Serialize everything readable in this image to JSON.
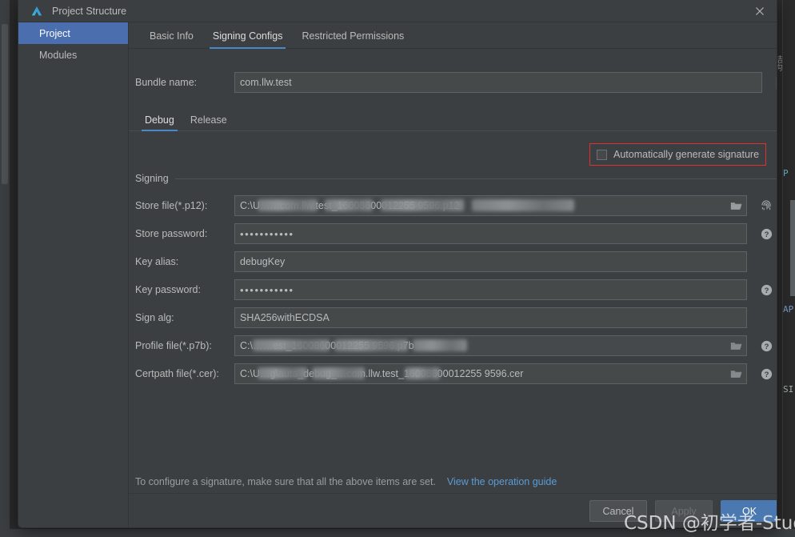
{
  "window": {
    "title": "Project Structure",
    "logo_icon": "deveco-studio-logo",
    "close_icon": "close-icon"
  },
  "sidebar": {
    "items": [
      {
        "label": "Project",
        "selected": true
      },
      {
        "label": "Modules",
        "selected": false
      }
    ]
  },
  "tabs": [
    {
      "label": "Basic Info",
      "active": false
    },
    {
      "label": "Signing Configs",
      "active": true
    },
    {
      "label": "Restricted Permissions",
      "active": false
    }
  ],
  "bundle": {
    "label": "Bundle name:",
    "value": "com.llw.test",
    "edit_icon": "edit-square-icon"
  },
  "subtabs": [
    {
      "label": "Debug",
      "active": true
    },
    {
      "label": "Release",
      "active": false
    }
  ],
  "autogen": {
    "label": "Automatically generate signature",
    "checked": false,
    "highlight_color": "#e03030",
    "checkbox_icon": "checkbox-unchecked-icon"
  },
  "signing": {
    "group_title": "Signing",
    "fields": [
      {
        "label": "Store file(*.p12):",
        "value": "C:\\U……com.llw.test_16008600012255 9596.p12",
        "display_prefix": "C:\\U",
        "display_suffix": "com.llw.test_16008600012255 9596.p12",
        "type": "file",
        "redacted": true,
        "folder_icon": "folder-open-icon",
        "trailing_icon": "fingerprint-icon"
      },
      {
        "label": "Store password:",
        "value": "•••••••••••",
        "type": "password",
        "redacted": false,
        "folder_icon": "",
        "trailing_icon": "help-icon"
      },
      {
        "label": "Key alias:",
        "value": "debugKey",
        "type": "text",
        "redacted": false,
        "folder_icon": "",
        "trailing_icon": ""
      },
      {
        "label": "Key password:",
        "value": "•••••••••••",
        "type": "password",
        "redacted": false,
        "folder_icon": "",
        "trailing_icon": "help-icon"
      },
      {
        "label": "Sign alg:",
        "value": "SHA256withECDSA",
        "type": "text",
        "redacted": false,
        "folder_icon": "",
        "trailing_icon": ""
      },
      {
        "label": "Profile file(*.p7b):",
        "value": "C:\\……est_16008600012255 9596.p7b",
        "display_prefix": "C:\\",
        "display_suffix": "est_16008600012255 9596.p7b",
        "type": "file",
        "redacted": true,
        "folder_icon": "folder-open-icon",
        "trailing_icon": "help-icon"
      },
      {
        "label": "Certpath file(*.cer):",
        "value": "C:\\U…g\\auto_debug_…com.llw.test_16008600012255 9596.cer",
        "display_prefix": "C:\\U",
        "display_suffix": "g\\auto_debug_……com.llw.test_16008600012255 9596.cer",
        "type": "file",
        "redacted": true,
        "folder_icon": "folder-open-icon",
        "trailing_icon": "help-icon"
      }
    ]
  },
  "footer": {
    "note": "To configure a signature, make sure that all the above items are set.",
    "link": "View the operation guide"
  },
  "buttons": [
    {
      "label": "Cancel",
      "style": "default",
      "enabled": true
    },
    {
      "label": "Apply",
      "style": "disabled",
      "enabled": false
    },
    {
      "label": "OK",
      "style": "primary",
      "enabled": true
    }
  ],
  "watermark": {
    "text": "CSDN @初学者-Study"
  },
  "background": {
    "vertical_tab": "结构",
    "code_fragments": [
      "P",
      "AP",
      "SI"
    ]
  },
  "colors": {
    "dialog_bg": "#3c3f41",
    "field_bg": "#45494a",
    "accent_blue": "#4a88c7",
    "selection_blue": "#4b6eaf",
    "primary_button": "#4a78b0",
    "link_blue": "#5a9bd8",
    "highlight_red": "#e03030",
    "text": "#bbbbbb"
  }
}
